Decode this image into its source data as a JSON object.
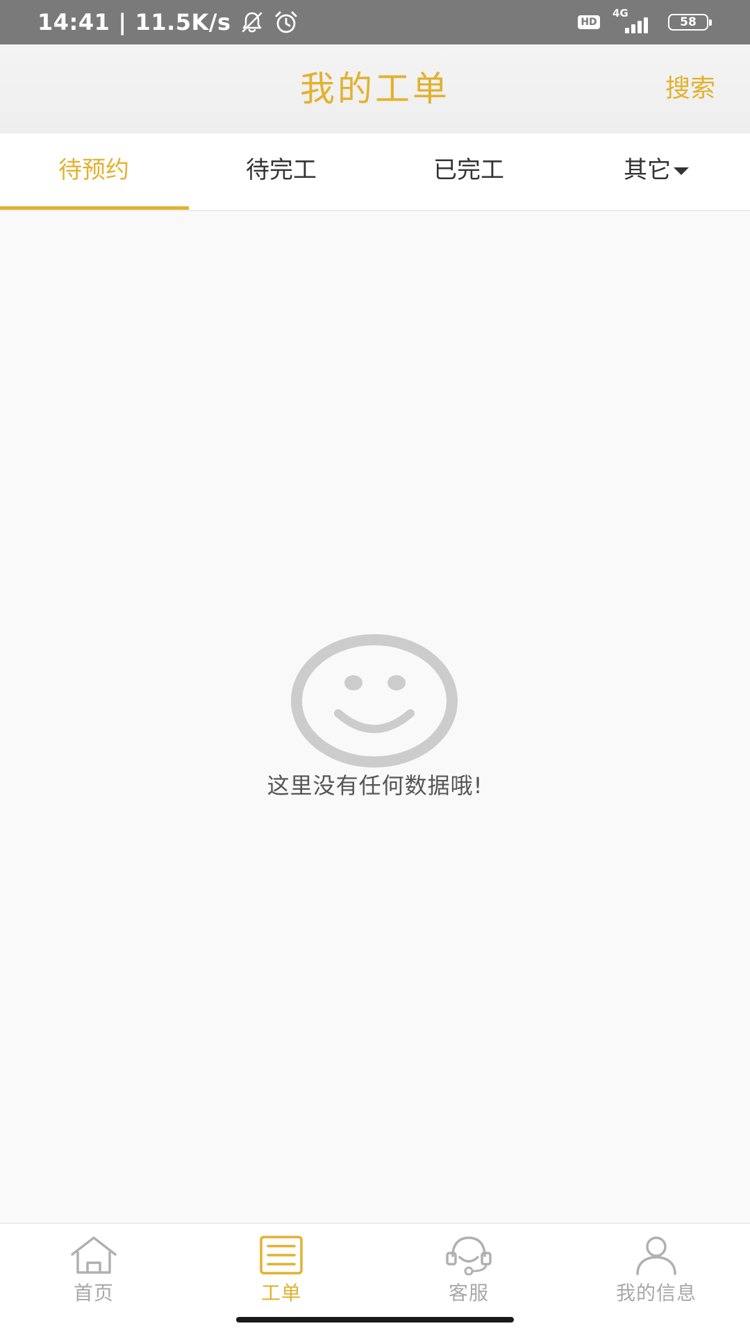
{
  "status_bar": {
    "time": "14:41",
    "separator": "|",
    "net_speed": "11.5K/s",
    "hd_badge": "HD",
    "network_type": "4G",
    "battery_level": "58",
    "icons": [
      "bell-off-icon",
      "alarm-icon",
      "signal-icon",
      "battery-icon"
    ]
  },
  "header": {
    "title": "我的工单",
    "search_label": "搜索"
  },
  "tabs": [
    {
      "label": "待预约",
      "active": true
    },
    {
      "label": "待完工",
      "active": false
    },
    {
      "label": "已完工",
      "active": false
    },
    {
      "label": "其它",
      "active": false,
      "has_dropdown": true
    }
  ],
  "empty_state": {
    "icon": "smiley-icon",
    "message": "这里没有任何数据哦!"
  },
  "bottom_nav": {
    "items": [
      {
        "label": "首页",
        "icon": "home-icon",
        "active": false
      },
      {
        "label": "工单",
        "icon": "work-order-icon",
        "active": true
      },
      {
        "label": "客服",
        "icon": "customer-service-icon",
        "active": false
      },
      {
        "label": "我的信息",
        "icon": "user-icon",
        "active": false
      }
    ]
  },
  "colors": {
    "accent": "#e2b12e",
    "status_bar": "#7a7a7a",
    "inactive": "#a8a8a8",
    "text": "#333333"
  }
}
